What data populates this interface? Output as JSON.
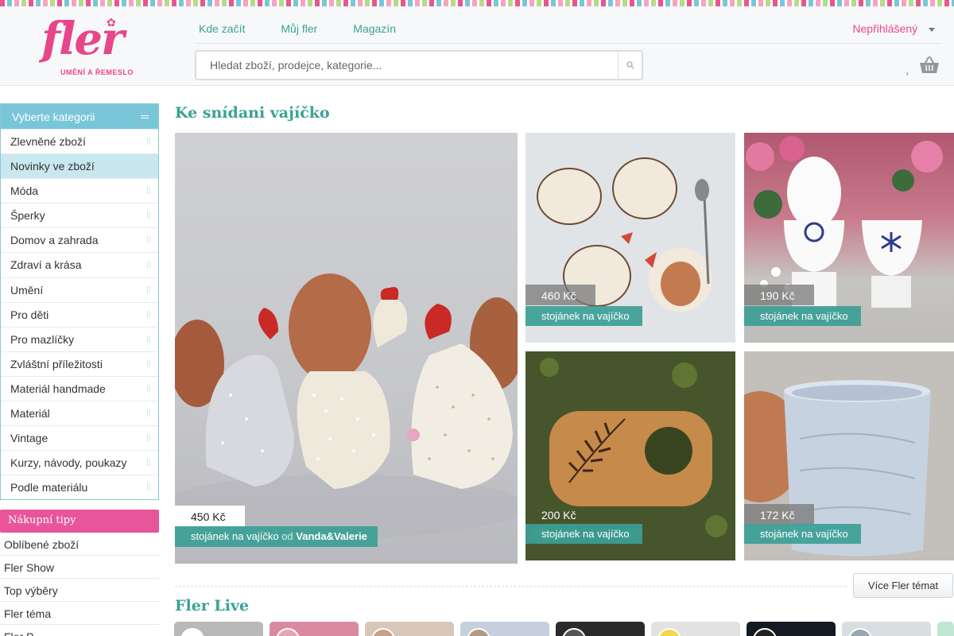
{
  "logo": {
    "wordmark": "fler",
    "tagline": "UMĚNÍ A ŘEMESLO"
  },
  "nav": {
    "items": [
      "Kde začít",
      "Můj fler",
      "Magazín"
    ]
  },
  "user": {
    "status": "Nepřihlášený"
  },
  "search": {
    "placeholder": "Hledat zboží, prodejce, kategorie..."
  },
  "header": {
    "basket_separator": ","
  },
  "sidebar": {
    "title": "Vyberte kategorii",
    "categories": [
      "Zlevněné zboží",
      "Novinky ve zboží",
      "Móda",
      "Šperky",
      "Domov a zahrada",
      "Zdraví a krása",
      "Umění",
      "Pro děti",
      "Pro mazlíčky",
      "Zvláštní příležitosti",
      "Materiál handmade",
      "Materiál",
      "Vintage",
      "Kurzy, návody, poukazy",
      "Podle materiálu"
    ],
    "active_index": 1
  },
  "tips": {
    "title": "Nákupní tipy",
    "items": [
      "Oblíbené zboží",
      "Fler Show",
      "Top výběry",
      "Fler téma",
      "Fler P..."
    ]
  },
  "main": {
    "section_title": "Ke snídani vajíčko",
    "products": [
      {
        "price": "450 Kč",
        "name": "stojánek na vajíčko",
        "by": "od",
        "seller": "Vanda&Valerie"
      },
      {
        "price": "460 Kč",
        "name": "stojánek na vajíčko"
      },
      {
        "price": "190 Kč",
        "name": "stojánek na vajíčko"
      },
      {
        "price": "200 Kč",
        "name": "stojánek na vajíčko"
      },
      {
        "price": "172 Kč",
        "name": "stojánek na vajíčko"
      }
    ],
    "more_button": "Více Fler témat",
    "live_title": "Fler Live"
  },
  "colors": {
    "brand_pink": "#e8468a",
    "teal": "#3aa294",
    "light_blue": "#79c6d9"
  }
}
